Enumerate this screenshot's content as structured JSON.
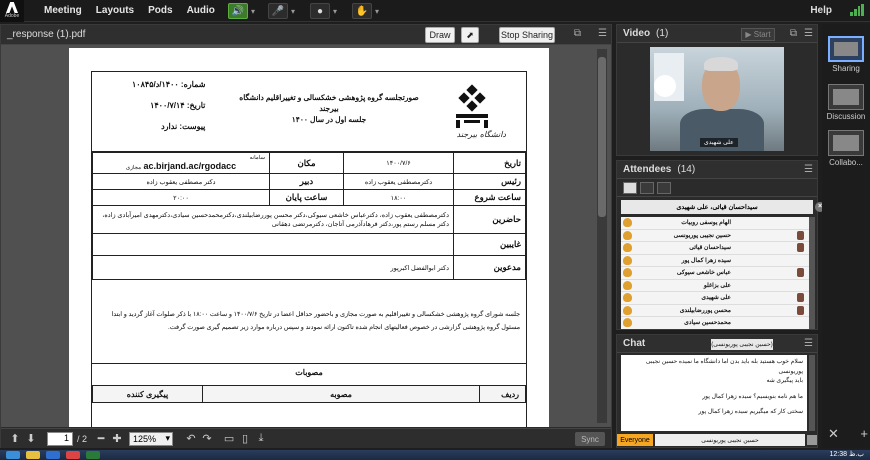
{
  "menubar": {
    "items": [
      "Meeting",
      "Layouts",
      "Pods",
      "Audio"
    ],
    "help": "Help"
  },
  "doc_pod": {
    "title": "_response (1).pdf",
    "draw_label": "Draw",
    "stop_sharing_label": "Stop Sharing"
  },
  "document": {
    "meta": {
      "number": "شماره: ۱۴۰۰/د/۱۰۸۴۵",
      "date": "تاریخ: ۱۴۰۰/۷/۱۴",
      "attachment": "پیوست: ندارد"
    },
    "session_title_line1": "صورتجلسه گروه پژوهشی خشکسالی و تغییراقلیم دانشگاه",
    "session_title_line2": "بیرجند",
    "session_title_line3": "جلسه اول در سال ۱۴۰۰",
    "university_name": "دانشگاه بیرجند",
    "rows": {
      "date_label": "تاریخ",
      "date_value": "۱۴۰۰/۷/۶",
      "place_label": "مکان",
      "place_value_small": "سامانه",
      "place_value_sub": "مجازی",
      "place_value": "ac.birjand.ac/rgodacc",
      "chair_label": "رئیس",
      "chair_value": "دکترمصطفی یعقوب زاده",
      "secretary_label": "دبیر",
      "secretary_value": "دکتر مصطفی یعقوب زاده",
      "start_label": "ساعت شروع",
      "start_value": "۱۸:۰۰",
      "end_label": "ساعت پایان",
      "end_value": "۲۰:۰۰",
      "present_label": "حاضرین",
      "present_value": "دکترمصطفی یعقوب زاده، دکترعباس خاشعی سیوکی،دکتر محسن پوررضابیلندی،دکترمحمدحسین سیادی،دکترمهدی امیرآبادی زاده، دکتر مسلم رستم پور،دکتر فرهادآذرمی آتاجان، دکترمرتضی دهقانی",
      "absent_label": "غایبین",
      "absent_value": "",
      "invited_label": "مدعوین",
      "invited_value": "دکتر ابوالفضل اکبرپور"
    },
    "minutes_text": "جلسه شورای گروه پژوهشی خشکسالی و تغییراقلیم به صورت مجازی و باحضور حداقل اعضا در تاریخ ۱۴۰۰/۷/۶ و ساعت ۱۸:۰۰ با ذکر صلوات آغاز گردید و ابتدا مسئول گروه پژوهشی گزارشی در خصوص فعالیتهای انجام شده تاکنون ارائه نمودند و سپس درباره موارد زیر تصمیم گیری صورت گرفت.",
    "approvals_title": "مصوبات",
    "approvals_headers": [
      "ردیف",
      "مصوبه",
      "پیگیری کننده"
    ]
  },
  "doc_toolbar": {
    "page_current": "1",
    "page_total": "/ 2",
    "zoom": "125%",
    "sync_label": "Sync"
  },
  "video_pod": {
    "title": "Video",
    "count": "(1)",
    "start_label": "Start",
    "participant_name": "علی شهیدی"
  },
  "attendees_pod": {
    "title": "Attendees",
    "count": "(14)",
    "selected": "سیداحسان قیاثی، علی شهیدی",
    "list": [
      "الهام یوسفی روبیات",
      "حسین نجیبی پوریونسی",
      "سیداحسان قیاثی",
      "سیده زهرا کمال پور",
      "عباس خاشعی سیوکی",
      "علی بزاغلو",
      "علی شهیدی",
      "محسن پوررضابیلندی",
      "محمدحسین سیادی"
    ]
  },
  "chat_pod": {
    "title": "Chat",
    "title_tag": "(حسین نجیبی پوریونسی)",
    "messages": [
      "سلام خوب هستید بله باید بدن اما دانشگاه ما نمیده حسین نجیبی پوریونسی",
      "باید پیگیری شه",
      "ما هم نامه بنویسیم؟ سیده زهرا کمال پور",
      "سختی کار که میگیریم سیده زهرا کمال پور"
    ],
    "everyone_label": "Everyone",
    "input_target": "حسین نجیبی پوریونسی"
  },
  "layouts": {
    "items": [
      "Sharing",
      "Discussion",
      "Collabo..."
    ]
  },
  "taskbar": {
    "clock": "12:38 ب.ظ"
  }
}
